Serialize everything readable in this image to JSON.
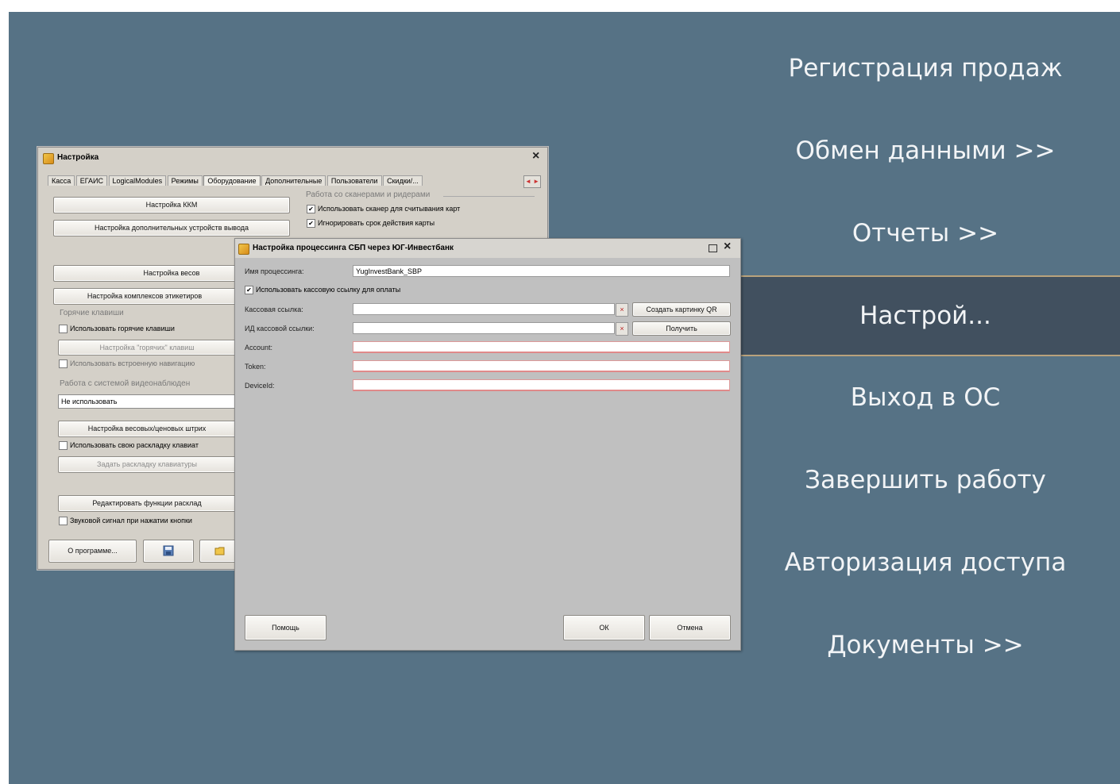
{
  "menu": [
    {
      "label": "Регистрация продаж",
      "active": false
    },
    {
      "label": "Обмен данными >>",
      "active": false
    },
    {
      "label": "Отчеты >>",
      "active": false
    },
    {
      "label": "Настрой...",
      "active": true
    },
    {
      "label": "Выход в ОС",
      "active": false
    },
    {
      "label": "Завершить работу",
      "active": false
    },
    {
      "label": "Авторизация доступа",
      "active": false
    },
    {
      "label": "Документы >>",
      "active": false
    }
  ],
  "settings_window": {
    "title": "Настройка",
    "close": "×",
    "tabs": [
      "Касса",
      "ЕГАИС",
      "LogicalModules",
      "Режимы",
      "Оборудование",
      "Дополнительные",
      "Пользователи",
      "Скидки/..."
    ],
    "tab_arrows": "◄ ►",
    "buttons": {
      "kkm": "Настройка ККМ",
      "output_devices": "Настройка дополнительных устройств вывода",
      "scales": "Настройка весов",
      "labeling": "Настройка комплексов этикетиров",
      "hotkeys_settings": "Настройка \"горячих\" клавиш",
      "barcodes": "Настройка весовых/ценовых штрих",
      "keyboard_layout": "Задать раскладку клавиатуры",
      "edit_functions": "Редактировать функции расклад",
      "about": "О программе..."
    },
    "groups": {
      "scanners": "Работа со сканерами и ридерами",
      "hotkeys": "Горячие клавиши",
      "video": "Работа с системой видеонаблюден"
    },
    "checkboxes": {
      "use_scanner": "Использовать сканер для считывания карт",
      "ignore_expiry": "Игнорировать срок действия карты",
      "use_hotkeys": "Использовать горячие клавиши",
      "builtin_nav": "Использовать встроенную навигацию",
      "own_layout": "Использовать свою раскладку клавиат",
      "sound": "Звуковой сигнал при нажатии кнопки"
    },
    "video_value": "Не использовать"
  },
  "sbp_dialog": {
    "title": "Настройка процессинга СБП через ЮГ-Инвестбанк",
    "fields": {
      "processing_name_label": "Имя процессинга:",
      "processing_name_value": "YugInvestBank_SBP",
      "use_cash_link": "Использовать кассовую ссылку для оплаты",
      "cash_link_label": "Кассовая ссылка:",
      "cash_link_id_label": "ИД кассовой ссылки:",
      "account_label": "Account:",
      "token_label": "Token:",
      "device_label": "DeviceId:"
    },
    "buttons": {
      "create_qr": "Создать картинку QR",
      "get": "Получить",
      "help": "Помощь",
      "ok": "ОК",
      "cancel": "Отмена",
      "clear": "×"
    }
  }
}
